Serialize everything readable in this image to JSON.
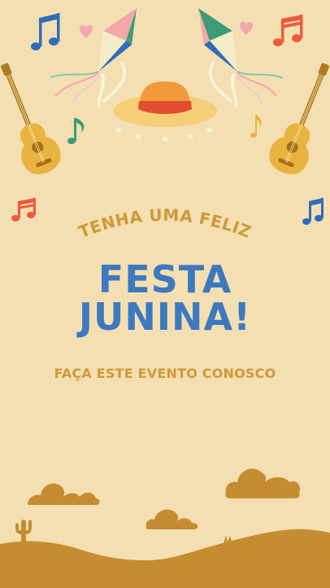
{
  "greeting": "TENHA UMA FELIZ",
  "headline": {
    "line1": "FESTA",
    "line2": "JUNINA!"
  },
  "subtitle": "FAÇA ESTE EVENTO CONOSCO",
  "colors": {
    "background": "#f4dfb2",
    "headline": "#3d79bf",
    "accent_gold": "#cf9838",
    "ground": "#c58d31"
  },
  "icons": [
    "music-note-icon",
    "kite-icon",
    "guitar-icon",
    "straw-hat-icon",
    "heart-icon",
    "star-icon",
    "cloud-icon",
    "cactus-icon"
  ]
}
